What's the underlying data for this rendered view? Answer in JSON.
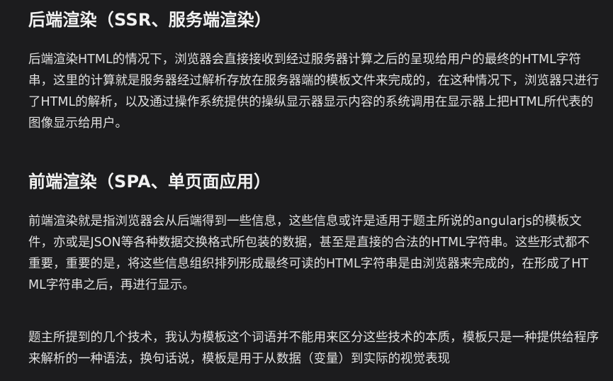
{
  "sections": [
    {
      "heading": "后端渲染（SSR、服务端渲染）",
      "paragraphs": [
        "后端渲染HTML的情况下，浏览器会直接接收到经过服务器计算之后的呈现给用户的最终的HTML字符串，这里的计算就是服务器经过解析存放在服务器端的模板文件来完成的，在这种情况下，浏览器只进行了HTML的解析，以及通过操作系统提供的操纵显示器显示内容的系统调用在显示器上把HTML所代表的图像显示给用户。"
      ]
    },
    {
      "heading": "前端渲染（SPA、单页面应用）",
      "paragraphs": [
        "前端渲染就是指浏览器会从后端得到一些信息，这些信息或许是适用于题主所说的angularjs的模板文件，亦或是JSON等各种数据交换格式所包装的数据，甚至是直接的合法的HTML字符串。这些形式都不重要，重要的是，将这些信息组织排列形成最终可读的HTML字符串是由浏览器来完成的，在形成了HTML字符串之后，再进行显示。",
        "题主所提到的几个技术，我认为模板这个词语并不能用来区分这些技术的本质，模板只是一种提供给程序来解析的一种语法，换句话说，模板是用于从数据（变量）到实际的视觉表现"
      ]
    }
  ]
}
